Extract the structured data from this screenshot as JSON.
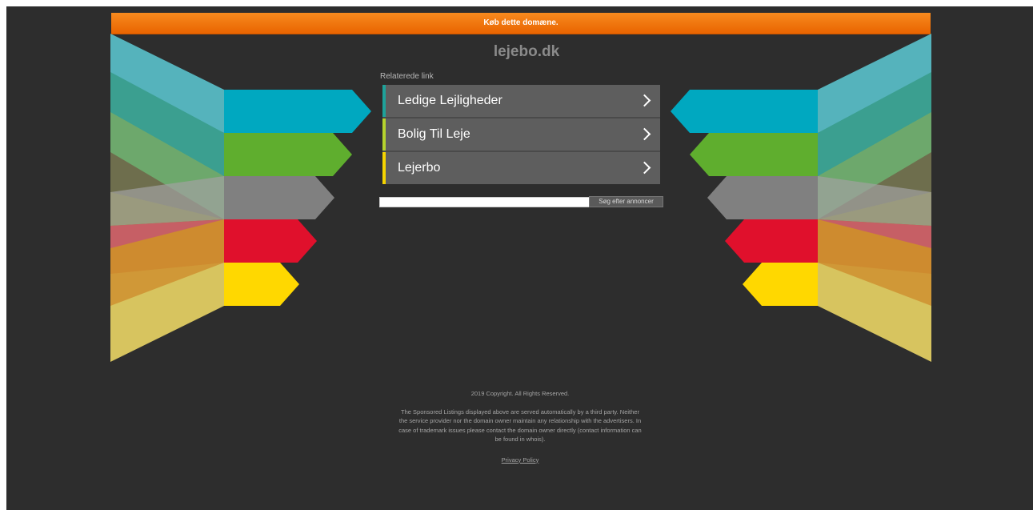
{
  "buy_bar": {
    "text": "Køb dette domæne."
  },
  "domain": {
    "title": "lejebo.dk"
  },
  "related": {
    "label": "Relaterede link",
    "links": [
      {
        "label": "Ledige Lejligheder",
        "accent": "#1ea29a"
      },
      {
        "label": "Bolig Til Leje",
        "accent": "#b5d32d"
      },
      {
        "label": "Lejerbo",
        "accent": "#f5d400"
      }
    ]
  },
  "search": {
    "value": "",
    "button_label": "Søg efter annoncer"
  },
  "footer": {
    "copyright": "2019 Copyright. All Rights Reserved.",
    "disclaimer": "The Sponsored Listings displayed above are served automatically by a third party. Neither the service provider nor the domain owner maintain any relationship with the advertisers. In case of trademark issues please contact the domain owner directly (contact information can be found in whois).",
    "privacy_link": "Privacy Policy"
  },
  "colors": {
    "background": "#2d2d2d",
    "buy_bar": "#f07a10",
    "cyan": "#00a8c0",
    "green": "#5fae2e",
    "gray": "#808080",
    "red": "#e0102c",
    "yellow": "#ffd800"
  }
}
